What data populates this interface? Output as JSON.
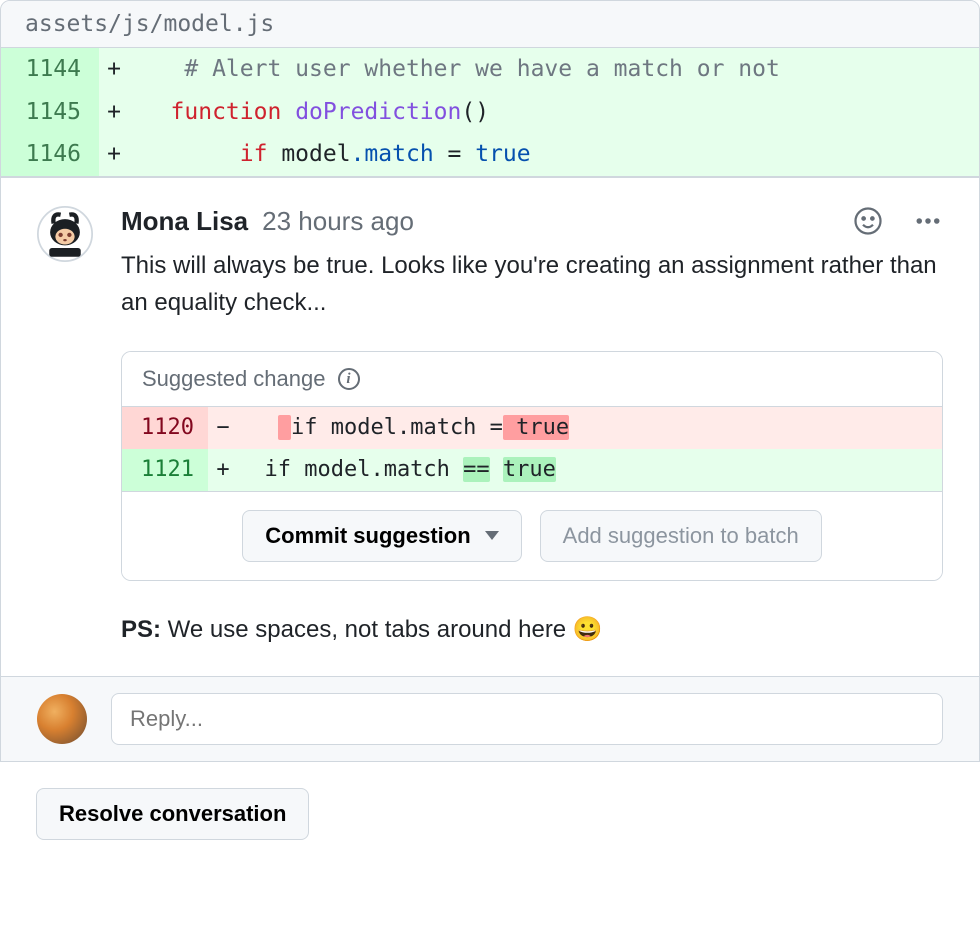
{
  "file_path": "assets/js/model.js",
  "diff": [
    {
      "num": "1144",
      "marker": "+",
      "segments": [
        {
          "cls": "",
          "t": "    "
        },
        {
          "cls": "tok-comment",
          "t": "# Alert user whether we have a match or not"
        }
      ]
    },
    {
      "num": "1145",
      "marker": "+",
      "segments": [
        {
          "cls": "",
          "t": "   "
        },
        {
          "cls": "tok-keyword",
          "t": "function"
        },
        {
          "cls": "",
          "t": " "
        },
        {
          "cls": "tok-func",
          "t": "doPrediction"
        },
        {
          "cls": "",
          "t": "()"
        }
      ]
    },
    {
      "num": "1146",
      "marker": "+",
      "segments": [
        {
          "cls": "",
          "t": "        "
        },
        {
          "cls": "tok-keyword",
          "t": "if"
        },
        {
          "cls": "",
          "t": " model"
        },
        {
          "cls": "tok-prop",
          "t": ".match"
        },
        {
          "cls": "",
          "t": " = "
        },
        {
          "cls": "tok-bool",
          "t": "true"
        }
      ]
    }
  ],
  "comment": {
    "author": "Mona Lisa",
    "timestamp": "23 hours ago",
    "body": "This will always be true. Looks like you're creating an assignment rather than an equality check...",
    "ps_label": "PS:",
    "ps_text": " We use spaces, not tabs around here ",
    "ps_emoji": "😀"
  },
  "suggestion": {
    "label": "Suggested change",
    "del": {
      "num": "1120",
      "marker": "−",
      "pre": "   ",
      "hl1": " ",
      "mid": "if model.match =",
      "hl2": " true"
    },
    "add": {
      "num": "1121",
      "marker": "+",
      "pre": "  if model.match ",
      "hl1": "==",
      "mid": " ",
      "hl2": "true"
    },
    "commit_label": "Commit suggestion",
    "batch_label": "Add suggestion to batch"
  },
  "reply": {
    "placeholder": "Reply..."
  },
  "resolve_label": "Resolve conversation"
}
